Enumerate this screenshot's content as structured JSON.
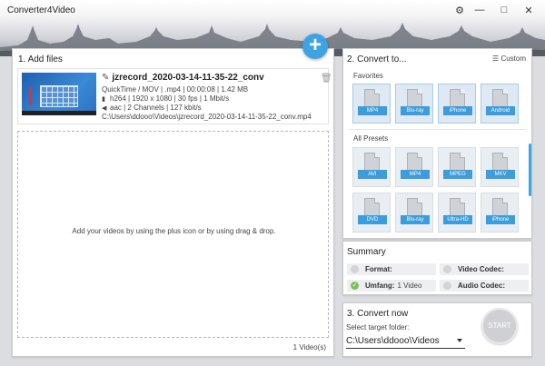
{
  "app": {
    "title": "Converter4Video"
  },
  "titlebar": {
    "settings_icon": "gear-icon",
    "minimize_icon": "minimize-icon",
    "maximize_icon": "maximize-icon",
    "close_icon": "close-icon"
  },
  "add_button": {
    "label": "+"
  },
  "add_files": {
    "title": "1. Add files",
    "file": {
      "name": "jzrecord_2020-03-14-11-35-22_conv",
      "container": "QuickTime / MOV | .mp4 | 00:00:08 | 1.42 MB",
      "video": "h264 | 1920 x 1080 | 30 fps | 1 Mbit/s",
      "audio": "aac | 2 Channels | 127 kbit/s",
      "path": "C:\\Users\\ddooo\\Videos\\jzrecord_2020-03-14-11-35-22_conv.mp4"
    },
    "drop_text": "Add your videos by using the plus icon or by using drag & drop.",
    "count": "1 Video(s)"
  },
  "convert_to": {
    "title": "2. Convert to...",
    "custom_label": "Custom",
    "favorites_label": "Favorites",
    "favorites": [
      "MP4",
      "Blu-ray",
      "iPhone",
      "Android"
    ],
    "all_presets_label": "All Presets",
    "presets_row1": [
      "AVI",
      "MP4",
      "MPEG",
      "MKV"
    ],
    "presets_row2": [
      "DVD",
      "Blu-ray",
      "Ultra-HD",
      "iPhone"
    ]
  },
  "summary": {
    "title": "Summary",
    "format_label": "Format:",
    "video_codec_label": "Video Codec:",
    "umfang_label": "Umfang:",
    "umfang_value": "1 Video",
    "audio_codec_label": "Audio Codec:"
  },
  "convert_now": {
    "title": "3. Convert now",
    "folder_label": "Select target folder:",
    "folder_value": "C:\\Users\\ddooo\\Videos",
    "start_label": "START"
  },
  "colors": {
    "accent": "#3ea3e3",
    "ok": "#7cc35b"
  }
}
